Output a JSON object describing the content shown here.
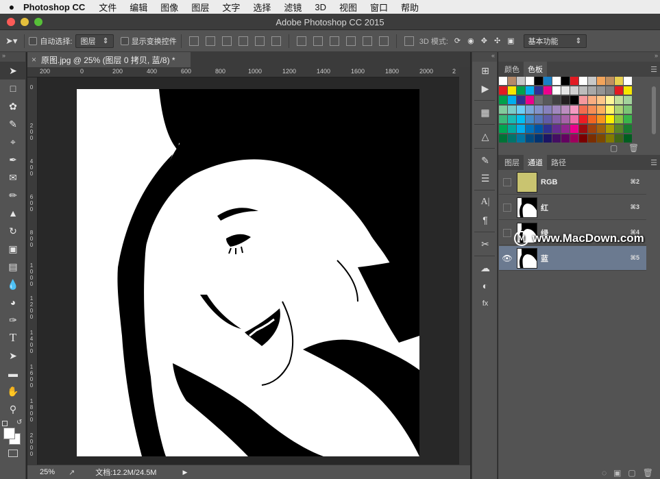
{
  "menubar": {
    "app_name": "Photoshop CC",
    "items": [
      "文件",
      "编辑",
      "图像",
      "图层",
      "文字",
      "选择",
      "滤镜",
      "3D",
      "视图",
      "窗口",
      "帮助"
    ]
  },
  "window": {
    "title": "Adobe Photoshop CC 2015",
    "controls": {
      "close": "#fc5b57",
      "minimize": "#e5bf3c",
      "zoom": "#57c038"
    }
  },
  "options_bar": {
    "auto_select_label": "自动选择:",
    "auto_select_value": "图层",
    "transform_controls_label": "显示变换控件",
    "mode_3d_label": "3D 模式:",
    "workspace": "基本功能"
  },
  "tools": [
    "move-tool",
    "marquee-tool",
    "lasso-tool",
    "quick-select-tool",
    "crop-tool",
    "eyedropper-tool",
    "healing-tool",
    "brush-tool",
    "stamp-tool",
    "history-brush-tool",
    "eraser-tool",
    "gradient-tool",
    "blur-tool",
    "dodge-tool",
    "pen-tool",
    "type-tool",
    "path-select-tool",
    "shape-tool",
    "hand-tool",
    "zoom-tool"
  ],
  "document": {
    "tab_title": "原图.jpg @ 25% (图层 0 拷贝, 蓝/8) *",
    "ruler_top": [
      "200",
      "0",
      "200",
      "400",
      "600",
      "800",
      "1000",
      "1200",
      "1400",
      "1600",
      "1800",
      "2000",
      "2"
    ],
    "ruler_left": [
      "0",
      "2 0 0",
      "4 0 0",
      "6 0 0",
      "8 0 0",
      "1 0 0 0",
      "1 2 0 0",
      "1 4 0 0",
      "1 6 0 0",
      "1 8 0 0",
      "2 0 0 0"
    ]
  },
  "status_bar": {
    "zoom": "25%",
    "doc_info": "文档:12.2M/24.5M"
  },
  "swatches_panel": {
    "tabs": [
      "颜色",
      "色板"
    ],
    "active_tab": "色板",
    "rows": [
      [
        "#ffffff",
        "#b58a6a",
        "#c8c8c8",
        "#ffffff",
        "#000000",
        "#1a7fc6",
        "#ffffff",
        "#000000",
        "#e21b22",
        "#ffffff",
        "#c8c8c8",
        "#f2a45b",
        "#c09060",
        "#e8d050",
        "#ffffff"
      ],
      [
        "#e21b22",
        "#f6e600",
        "#00a14b",
        "#00adef",
        "#2e3192",
        "#ec008c",
        "#ffffff",
        "#e6e6e6",
        "#d0d0d0",
        "#bcbcbc",
        "#a8a8a8",
        "#949494",
        "#808080",
        "#e21b22",
        "#f6e600"
      ],
      [
        "#00a14b",
        "#00adef",
        "#2e3192",
        "#ec008c",
        "#6d6e71",
        "#58595b",
        "#414042",
        "#231f20",
        "#000000",
        "#f5989d",
        "#f9ad81",
        "#fdc689",
        "#fff799",
        "#c4df9b",
        "#a3d39c"
      ],
      [
        "#82ca9c",
        "#7accc8",
        "#6dcff6",
        "#7da7d9",
        "#8393ca",
        "#8781bd",
        "#a187be",
        "#bc8dbf",
        "#f49ac1",
        "#f26c4f",
        "#f68e56",
        "#fbaf5d",
        "#fff568",
        "#acd373",
        "#7cc576"
      ],
      [
        "#3bb878",
        "#1abbb4",
        "#00bff3",
        "#438ccb",
        "#5574b9",
        "#605ca8",
        "#855fa8",
        "#a763a8",
        "#f06ea9",
        "#ed1c24",
        "#f26522",
        "#f7941d",
        "#fff200",
        "#8dc63f",
        "#39b54a"
      ],
      [
        "#00a651",
        "#00a99d",
        "#00aeef",
        "#0072bc",
        "#0054a6",
        "#2e3192",
        "#662d91",
        "#92278f",
        "#ec008c",
        "#9e0b0f",
        "#a0410d",
        "#a3620a",
        "#aba000",
        "#598527",
        "#197b30"
      ],
      [
        "#007236",
        "#00746b",
        "#0076a3",
        "#004a80",
        "#003471",
        "#1b1464",
        "#440e62",
        "#630460",
        "#9e005d",
        "#790000",
        "#7b2e00",
        "#7d4900",
        "#827b00",
        "#406618",
        "#005e20"
      ]
    ]
  },
  "channels_panel": {
    "tabs": [
      "图层",
      "通道",
      "路径"
    ],
    "active_tab": "通道",
    "channels": [
      {
        "name": "RGB",
        "shortcut": "⌘2",
        "visible": false,
        "selected": false
      },
      {
        "name": "红",
        "shortcut": "⌘3",
        "visible": false,
        "selected": false
      },
      {
        "name": "绿",
        "shortcut": "⌘4",
        "visible": false,
        "selected": false
      },
      {
        "name": "蓝",
        "shortcut": "⌘5",
        "visible": true,
        "selected": true
      }
    ]
  },
  "watermark": "www.MacDown.com"
}
